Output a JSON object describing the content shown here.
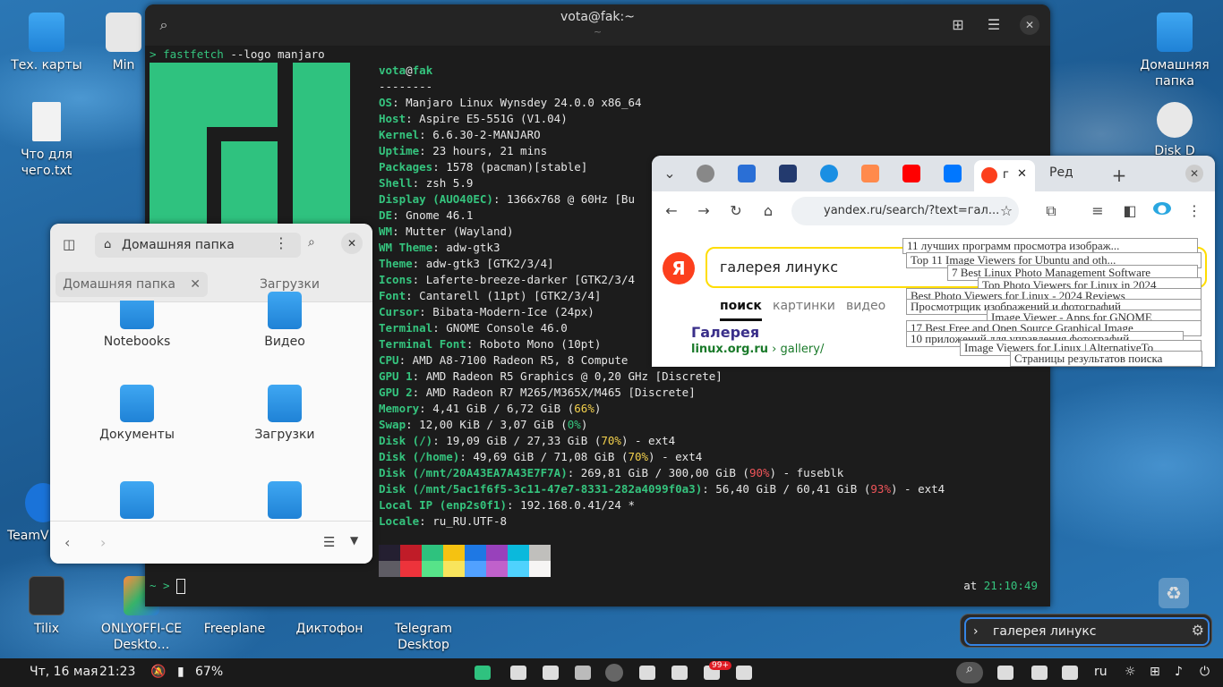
{
  "desktop": {
    "icons": [
      {
        "label": "Тех. карты",
        "type": "folder"
      },
      {
        "label": "Min",
        "type": "folder"
      },
      {
        "label": "Что для чего.txt",
        "type": "file"
      },
      {
        "label": "TeamV",
        "type": "app"
      },
      {
        "label": "Tilix",
        "type": "term"
      },
      {
        "label": "ONLYOFFI-CE Deskto…",
        "type": "only"
      },
      {
        "label": "Freeplane",
        "type": "app"
      },
      {
        "label": "Диктофон",
        "type": "app"
      },
      {
        "label": "Telegram Desktop",
        "type": "app"
      },
      {
        "label": "Домашняя папка",
        "type": "folder"
      },
      {
        "label": "Disk D",
        "type": "disk"
      }
    ]
  },
  "terminal": {
    "title": "vota@fak:~",
    "subtitle": "~",
    "command_prompt": ">",
    "command": "fastfetch",
    "command_args": "--logo manjaro",
    "user": "vota",
    "at": "@",
    "host": "fak",
    "separator": "--------",
    "info": [
      {
        "k": "OS",
        "v": "Manjaro Linux Wynsdey 24.0.0 x86_64"
      },
      {
        "k": "Host",
        "v": "Aspire E5-551G (V1.04)"
      },
      {
        "k": "Kernel",
        "v": "6.6.30-2-MANJARO"
      },
      {
        "k": "Uptime",
        "v": "23 hours, 21 mins"
      },
      {
        "k": "Packages",
        "v": "1578 (pacman)[stable]"
      },
      {
        "k": "Shell",
        "v": "zsh 5.9"
      },
      {
        "k": "Display (AUO40EC)",
        "v": "1366x768 @ 60Hz [Bu"
      },
      {
        "k": "DE",
        "v": "Gnome 46.1"
      },
      {
        "k": "WM",
        "v": "Mutter (Wayland)"
      },
      {
        "k": "WM Theme",
        "v": "adw-gtk3"
      },
      {
        "k": "Theme",
        "v": "adw-gtk3 [GTK2/3/4]"
      },
      {
        "k": "Icons",
        "v": "Laferte-breeze-darker [GTK2/3/4"
      },
      {
        "k": "Font",
        "v": "Cantarell (11pt) [GTK2/3/4]"
      },
      {
        "k": "Cursor",
        "v": "Bibata-Modern-Ice (24px)"
      },
      {
        "k": "Terminal",
        "v": "GNOME Console 46.0"
      },
      {
        "k": "Terminal Font",
        "v": "Roboto Mono (10pt)"
      },
      {
        "k": "CPU",
        "v": "AMD A8-7100 Radeon R5, 8 Compute"
      },
      {
        "k": "GPU 1",
        "v": "AMD Radeon R5 Graphics @ 0,20 GHz [Discrete]"
      },
      {
        "k": "GPU 2",
        "v": "AMD Radeon R7 M265/M365X/M465 [Discrete]"
      },
      {
        "k": "Memory",
        "v": "4,41 GiB / 6,72 GiB (",
        "pct": "66%",
        "pc": "y",
        "tail": ")"
      },
      {
        "k": "Swap",
        "v": "12,00 KiB / 3,07 GiB (",
        "pct": "0%",
        "pc": "cy",
        "tail": ")"
      },
      {
        "k": "Disk (/)",
        "v": "19,09 GiB / 27,33 GiB (",
        "pct": "70%",
        "pc": "y",
        "tail": ") - ext4"
      },
      {
        "k": "Disk (/home)",
        "v": "49,69 GiB / 71,08 GiB (",
        "pct": "70%",
        "pc": "y",
        "tail": ") - ext4"
      },
      {
        "k": "Disk (/mnt/20A43EA7A43E7F7A)",
        "v": "269,81 GiB / 300,00 GiB (",
        "pct": "90%",
        "pc": "r",
        "tail": ") - fuseblk"
      },
      {
        "k": "Disk (/mnt/5ac1f6f5-3c11-47e7-8331-282a4099f0a3)",
        "v": "56,40 GiB / 60,41 GiB (",
        "pct": "93%",
        "pc": "r",
        "tail": ") - ext4"
      },
      {
        "k": "Local IP (enp2s0f1)",
        "v": "192.168.0.41/24 *"
      },
      {
        "k": "Locale",
        "v": "ru_RU.UTF-8"
      }
    ],
    "palette": [
      "#241f31",
      "#c01c28",
      "#2ec27e",
      "#f5c211",
      "#1e78e4",
      "#9841bb",
      "#0ab9dc",
      "#c0bfbc",
      "#5e5c64",
      "#ed333b",
      "#57e389",
      "#f8e45c",
      "#51a1ff",
      "#c061cb",
      "#4fd2fd",
      "#f6f5f4"
    ],
    "prompt": "~ >",
    "clock_prefix": "at",
    "clock": "21:10:49"
  },
  "browser": {
    "tabs": [
      {
        "icon": "globe-icon"
      },
      {
        "icon": "y-icon"
      },
      {
        "icon": "r-icon"
      },
      {
        "icon": "cloud-icon"
      },
      {
        "icon": "heart-icon"
      },
      {
        "icon": "youtube-icon"
      },
      {
        "icon": "vk-icon"
      }
    ],
    "active_tab_label": "г",
    "next_tab_label": "Ред",
    "url": "yandex.ru/search/?text=гал...",
    "yandex_logo": "Я",
    "search_query": "галерея линукс",
    "search_tabs": [
      "поиск",
      "картинки",
      "видео"
    ],
    "result_title": "Галерея",
    "result_url_host": "linux.org.ru",
    "result_url_path": "› gallery/",
    "suggestions": [
      "11 лучших программ просмотра изображ...",
      "Top 11 Image Viewers for Ubuntu and oth...",
      "7 Best Linux Photo Management Software",
      "Top Photo Viewers for Linux in 2024",
      "Best Photo Viewers for Linux - 2024 Reviews",
      "Просмотрщик изображений и фотографий",
      "Image Viewer - Apps for GNOME",
      "17 Best Free and Open Source Graphical Image",
      "10 приложений для управления фотографий",
      "Image Viewers for Linux | AlternativeTo",
      "Страницы результатов поиска"
    ]
  },
  "files": {
    "path": "Домашняя папка",
    "tabs": [
      "Домашняя папка",
      "Загрузки"
    ],
    "items": [
      "Notebooks",
      "Видео",
      "Документы",
      "Загрузки",
      "",
      ""
    ]
  },
  "launcher": {
    "query": "галерея линукс"
  },
  "taskbar": {
    "date": "Чт, 16 мая",
    "time": "21:23",
    "battery": "67%",
    "badge": "99+",
    "lang": "ru"
  }
}
